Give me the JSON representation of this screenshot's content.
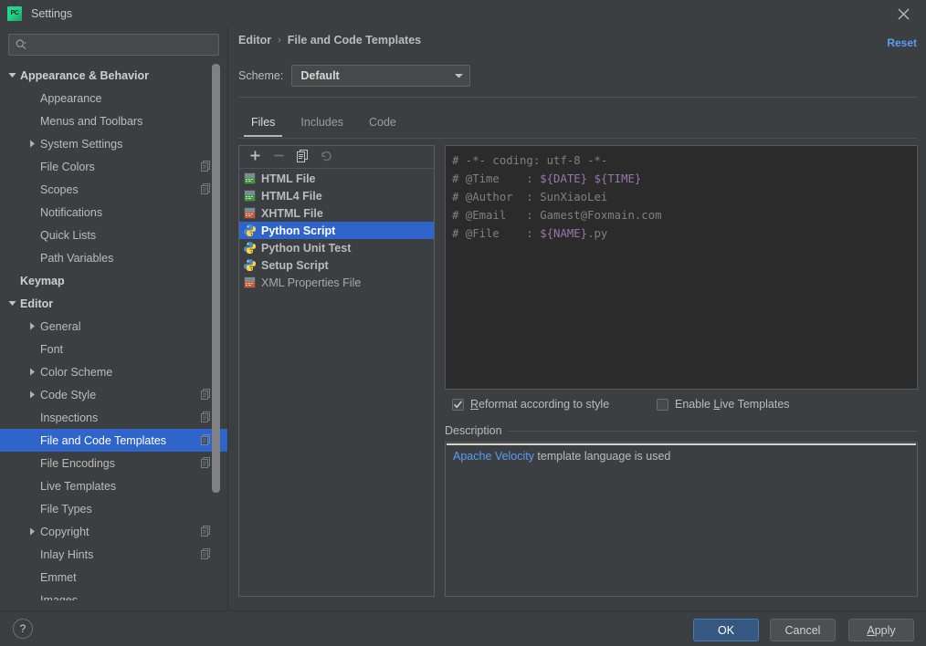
{
  "window": {
    "title": "Settings",
    "app_icon": "pycharm-icon",
    "app_icon_text": "PC",
    "close_icon": "close-icon",
    "reset_label": "Reset",
    "accent_blue": "#2f65ca",
    "link_blue": "#589df6",
    "bg": "#3c3f41",
    "editor_bg": "#2b2b2b"
  },
  "search": {
    "placeholder": "",
    "value": "",
    "icon": "search-icon"
  },
  "sidebar": {
    "items": [
      {
        "label": "Appearance & Behavior",
        "indent": 0,
        "twisty": "down",
        "bold": true,
        "badge": false,
        "selected": false
      },
      {
        "label": "Appearance",
        "indent": 1,
        "twisty": "none",
        "bold": false,
        "badge": false,
        "selected": false
      },
      {
        "label": "Menus and Toolbars",
        "indent": 1,
        "twisty": "none",
        "bold": false,
        "badge": false,
        "selected": false
      },
      {
        "label": "System Settings",
        "indent": 1,
        "twisty": "right",
        "bold": false,
        "badge": false,
        "selected": false
      },
      {
        "label": "File Colors",
        "indent": 1,
        "twisty": "none",
        "bold": false,
        "badge": true,
        "selected": false
      },
      {
        "label": "Scopes",
        "indent": 1,
        "twisty": "none",
        "bold": false,
        "badge": true,
        "selected": false
      },
      {
        "label": "Notifications",
        "indent": 1,
        "twisty": "none",
        "bold": false,
        "badge": false,
        "selected": false
      },
      {
        "label": "Quick Lists",
        "indent": 1,
        "twisty": "none",
        "bold": false,
        "badge": false,
        "selected": false
      },
      {
        "label": "Path Variables",
        "indent": 1,
        "twisty": "none",
        "bold": false,
        "badge": false,
        "selected": false
      },
      {
        "label": "Keymap",
        "indent": 0,
        "twisty": "none",
        "bold": true,
        "badge": false,
        "selected": false
      },
      {
        "label": "Editor",
        "indent": 0,
        "twisty": "down",
        "bold": true,
        "badge": false,
        "selected": false
      },
      {
        "label": "General",
        "indent": 1,
        "twisty": "right",
        "bold": false,
        "badge": false,
        "selected": false
      },
      {
        "label": "Font",
        "indent": 1,
        "twisty": "none",
        "bold": false,
        "badge": false,
        "selected": false
      },
      {
        "label": "Color Scheme",
        "indent": 1,
        "twisty": "right",
        "bold": false,
        "badge": false,
        "selected": false
      },
      {
        "label": "Code Style",
        "indent": 1,
        "twisty": "right",
        "bold": false,
        "badge": true,
        "selected": false
      },
      {
        "label": "Inspections",
        "indent": 1,
        "twisty": "none",
        "bold": false,
        "badge": true,
        "selected": false
      },
      {
        "label": "File and Code Templates",
        "indent": 1,
        "twisty": "none",
        "bold": false,
        "badge": true,
        "selected": true
      },
      {
        "label": "File Encodings",
        "indent": 1,
        "twisty": "none",
        "bold": false,
        "badge": true,
        "selected": false
      },
      {
        "label": "Live Templates",
        "indent": 1,
        "twisty": "none",
        "bold": false,
        "badge": false,
        "selected": false
      },
      {
        "label": "File Types",
        "indent": 1,
        "twisty": "none",
        "bold": false,
        "badge": false,
        "selected": false
      },
      {
        "label": "Copyright",
        "indent": 1,
        "twisty": "right",
        "bold": false,
        "badge": true,
        "selected": false
      },
      {
        "label": "Inlay Hints",
        "indent": 1,
        "twisty": "none",
        "bold": false,
        "badge": true,
        "selected": false
      },
      {
        "label": "Emmet",
        "indent": 1,
        "twisty": "none",
        "bold": false,
        "badge": false,
        "selected": false
      },
      {
        "label": "Images",
        "indent": 1,
        "twisty": "none",
        "bold": false,
        "badge": false,
        "selected": false
      }
    ]
  },
  "main": {
    "breadcrumb": {
      "parent": "Editor",
      "separator": "›",
      "current": "File and Code Templates"
    },
    "scheme": {
      "label": "Scheme:",
      "value": "Default",
      "chevron": "chevron-down-icon"
    },
    "tabs": [
      {
        "label": "Files",
        "active": true
      },
      {
        "label": "Includes",
        "active": false
      },
      {
        "label": "Code",
        "active": false
      }
    ],
    "filelist": {
      "toolbar": [
        {
          "name": "add-template-button",
          "icon": "plus-icon",
          "enabled": true
        },
        {
          "name": "remove-template-button",
          "icon": "minus-icon",
          "enabled": false
        },
        {
          "name": "copy-template-button",
          "icon": "copy-icon",
          "enabled": true
        },
        {
          "name": "reset-template-button",
          "icon": "undo-icon",
          "enabled": false
        }
      ],
      "items": [
        {
          "label": "HTML File",
          "icon": "html-file-icon",
          "selected": false,
          "dim": false
        },
        {
          "label": "HTML4 File",
          "icon": "html-file-icon",
          "selected": false,
          "dim": false
        },
        {
          "label": "XHTML File",
          "icon": "xhtml-file-icon",
          "selected": false,
          "dim": false
        },
        {
          "label": "Python Script",
          "icon": "python-file-icon",
          "selected": true,
          "dim": false
        },
        {
          "label": "Python Unit Test",
          "icon": "python-file-icon",
          "selected": false,
          "dim": false
        },
        {
          "label": "Setup Script",
          "icon": "python-file-icon",
          "selected": false,
          "dim": false
        },
        {
          "label": "XML Properties File",
          "icon": "xml-file-icon",
          "selected": false,
          "dim": true
        }
      ]
    },
    "editor": {
      "lines": [
        [
          {
            "t": "# -*- coding: utf-8 -*-",
            "c": "comment"
          }
        ],
        [
          {
            "t": "# @Time    : ",
            "c": "comment"
          },
          {
            "t": "${DATE} ${TIME}",
            "c": "var"
          }
        ],
        [
          {
            "t": "# @Author  : SunXiaoLei",
            "c": "comment"
          }
        ],
        [
          {
            "t": "# @Email   : Gamest@Foxmain.com",
            "c": "comment"
          }
        ],
        [
          {
            "t": "# @File    : ",
            "c": "comment"
          },
          {
            "t": "${NAME}",
            "c": "var"
          },
          {
            "t": ".py",
            "c": "comment"
          }
        ]
      ]
    },
    "options": [
      {
        "name": "reformat-according-to-style-checkbox",
        "label_before": "R",
        "label_after": "eformat according to style",
        "checked": true
      },
      {
        "name": "enable-live-templates-checkbox",
        "label_before_plain": "Enable ",
        "label_before": "L",
        "label_after": "ive Templates",
        "checked": false
      }
    ],
    "description": {
      "title": "Description",
      "link_text": "Apache Velocity",
      "rest_text": " template language is used"
    }
  },
  "footer": {
    "help_label": "?",
    "ok_label": "OK",
    "cancel_label": "Cancel",
    "apply_label_underlined": "A",
    "apply_label_rest": "pply"
  }
}
